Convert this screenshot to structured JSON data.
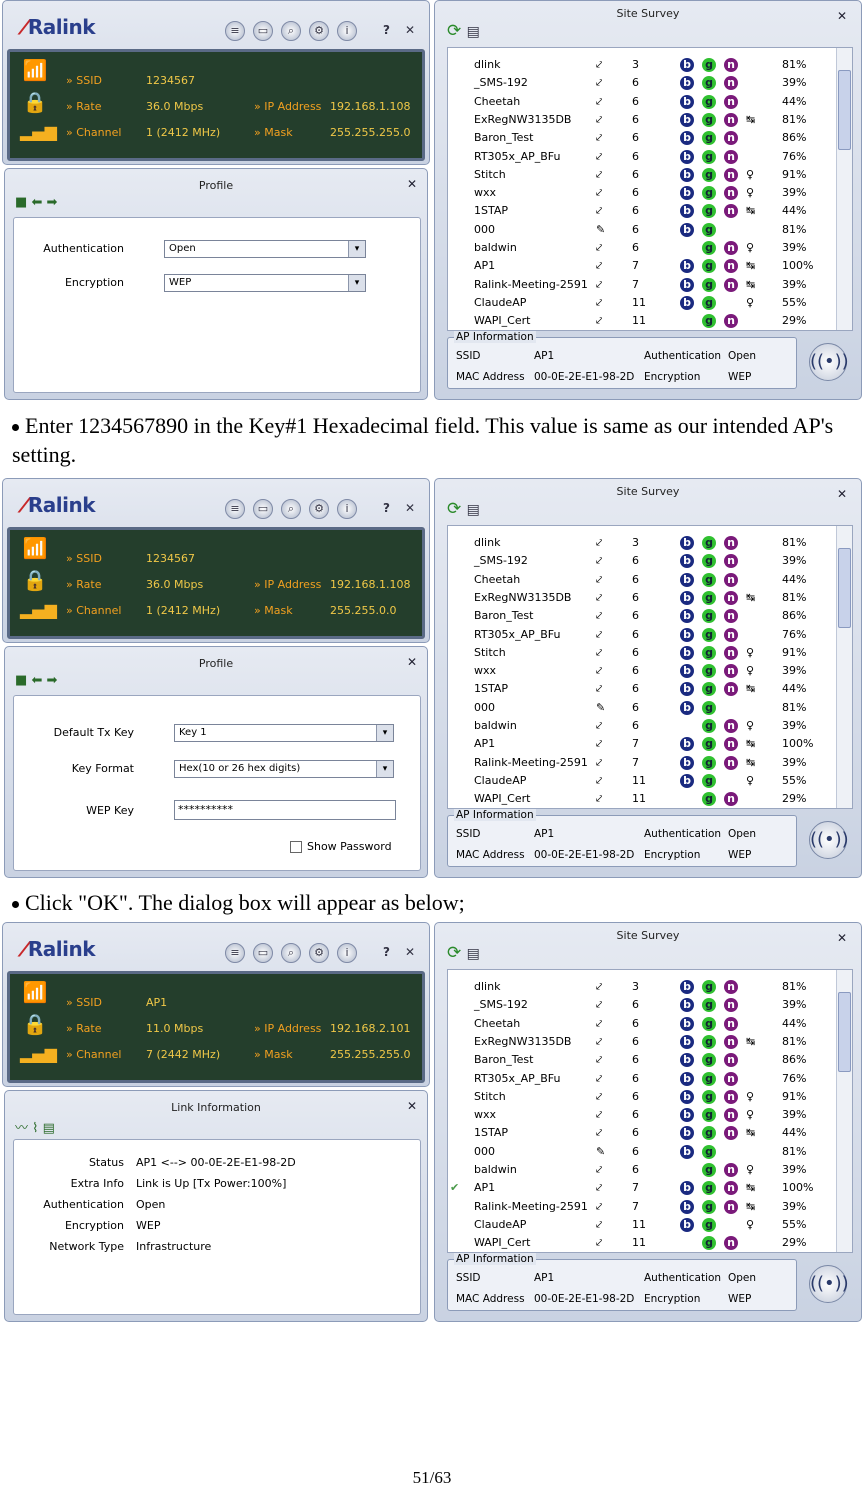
{
  "toolbar_buttons": [
    "≡",
    "▭",
    "⌕",
    "⚙",
    "i"
  ],
  "help_label": "?",
  "close_label": "✕",
  "logo": "Ralink",
  "site_survey_title": "Site Survey",
  "ap_info_caption": "AP Information",
  "ap_info": {
    "ssid_label": "SSID",
    "ssid": "AP1",
    "auth_label": "Authentication",
    "auth": "Open",
    "mac_label": "MAC Address",
    "mac": "00-0E-2E-E1-98-2D",
    "enc_label": "Encryption",
    "enc": "WEP"
  },
  "status_labels": {
    "ssid": "SSID",
    "rate": "Rate",
    "channel": "Channel",
    "ip": "IP Address",
    "mask": "Mask"
  },
  "networks": [
    {
      "name": "dlink",
      "ch": "3",
      "b": true,
      "g": true,
      "n": true,
      "extra": "",
      "signal": "81%"
    },
    {
      "name": "_SMS-192",
      "ch": "6",
      "b": true,
      "g": true,
      "n": true,
      "extra": "",
      "signal": "39%"
    },
    {
      "name": "Cheetah",
      "ch": "6",
      "b": true,
      "g": true,
      "n": true,
      "extra": "",
      "signal": "44%"
    },
    {
      "name": "ExRegNW3135DB",
      "ch": "6",
      "b": true,
      "g": true,
      "n": true,
      "extra": "↹",
      "signal": "81%"
    },
    {
      "name": "Baron_Test",
      "ch": "6",
      "b": true,
      "g": true,
      "n": true,
      "extra": "",
      "signal": "86%"
    },
    {
      "name": "RT305x_AP_BFu",
      "ch": "6",
      "b": true,
      "g": true,
      "n": true,
      "extra": "",
      "signal": "76%"
    },
    {
      "name": "Stitch",
      "ch": "6",
      "b": true,
      "g": true,
      "n": true,
      "extra": "♀",
      "signal": "91%"
    },
    {
      "name": "wxx",
      "ch": "6",
      "b": true,
      "g": true,
      "n": true,
      "extra": "♀",
      "signal": "39%"
    },
    {
      "name": "1STAP",
      "ch": "6",
      "b": true,
      "g": true,
      "n": true,
      "extra": "↹",
      "signal": "44%"
    },
    {
      "name": "000",
      "ch": "6",
      "b": true,
      "g": true,
      "n": false,
      "extra": "",
      "signal": "81%"
    },
    {
      "name": "baldwin",
      "ch": "6",
      "b": false,
      "g": true,
      "n": true,
      "extra": "♀",
      "signal": "39%"
    },
    {
      "name": "AP1",
      "ch": "7",
      "b": true,
      "g": true,
      "n": true,
      "extra": "↹",
      "signal": "100%"
    },
    {
      "name": "Ralink-Meeting-2591",
      "ch": "7",
      "b": true,
      "g": true,
      "n": true,
      "extra": "↹",
      "signal": "39%"
    },
    {
      "name": "ClaudeAP",
      "ch": "11",
      "b": true,
      "g": true,
      "n": false,
      "extra": "♀",
      "signal": "55%"
    },
    {
      "name": "WAPI_Cert",
      "ch": "11",
      "b": false,
      "g": true,
      "n": true,
      "extra": "",
      "signal": "29%"
    }
  ],
  "screens": [
    {
      "status": {
        "ssid": "1234567",
        "rate": "36.0 Mbps",
        "channel": "1 (2412 MHz)",
        "ip": "192.168.1.108",
        "mask": "255.255.255.0"
      },
      "panel_title": "Profile",
      "fields": [
        {
          "label": "Authentication",
          "value": "Open"
        },
        {
          "label": "Encryption",
          "value": "WEP"
        }
      ]
    },
    {
      "status": {
        "ssid": "1234567",
        "rate": "36.0 Mbps",
        "channel": "1 (2412 MHz)",
        "ip": "192.168.1.108",
        "mask": "255.255.0.0"
      },
      "panel_title": "Profile",
      "fields": [
        {
          "label": "Default Tx Key",
          "value": "Key 1"
        },
        {
          "label": "Key Format",
          "value": "Hex(10 or 26 hex digits)"
        }
      ],
      "wep_key_label": "WEP Key",
      "wep_key_value": "**********",
      "show_password": "Show Password"
    },
    {
      "status": {
        "ssid": "AP1",
        "rate": "11.0 Mbps",
        "channel": "7 (2442 MHz)",
        "ip": "192.168.2.101",
        "mask": "255.255.255.0"
      },
      "panel_title": "Link Information",
      "link": [
        {
          "label": "Status",
          "value": "AP1 <--> 00-0E-2E-E1-98-2D"
        },
        {
          "label": "Extra Info",
          "value": "Link is Up  [Tx Power:100%]"
        },
        {
          "label": "Authentication",
          "value": "Open"
        },
        {
          "label": "Encryption",
          "value": "WEP"
        },
        {
          "label": "Network Type",
          "value": "Infrastructure"
        }
      ],
      "connected": "AP1"
    }
  ],
  "instructions": [
    "Enter 1234567890 in the Key#1 Hexadecimal field. This value is same as our intended AP's setting.",
    "Click \"OK\". The dialog box will appear as below;"
  ],
  "page_number": "51/63"
}
